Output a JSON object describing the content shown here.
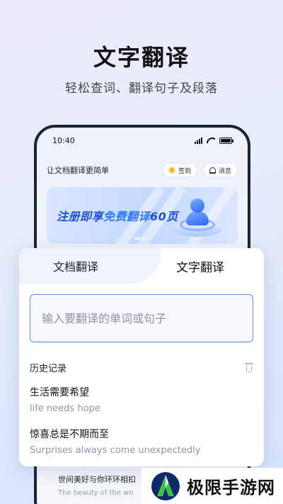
{
  "promo": {
    "title": "文字翻译",
    "subtitle": "轻松查词、翻译句子及段落"
  },
  "phone": {
    "status": {
      "time": "10:40"
    },
    "header": {
      "title": "让文档翻译更简单",
      "checkin_label": "签到",
      "messages_label": "消息"
    },
    "banner": {
      "text_a": "注册即享",
      "text_b": "免费翻译",
      "text_c": "60页"
    }
  },
  "translator": {
    "tabs": [
      {
        "label": "文档翻译"
      },
      {
        "label": "文字翻译",
        "active": true
      }
    ],
    "input": {
      "placeholder": "输入要翻译的单词或句子",
      "value": ""
    },
    "history": {
      "title": "历史记录",
      "items": [
        {
          "source": "生活需要希望",
          "translation": "life needs hope"
        },
        {
          "source": "惊喜总是不期而至",
          "translation": "Surprises always come unexpectedly"
        }
      ]
    }
  },
  "peek_item": {
    "source": "世间美好与你环环相扣",
    "translation": "The beauty of the wo"
  },
  "watermark": {
    "text": "极限手游网"
  },
  "colors": {
    "accent": "#2f7bff",
    "input_border": "#5b8def",
    "phone_frame": "#1b2433"
  }
}
